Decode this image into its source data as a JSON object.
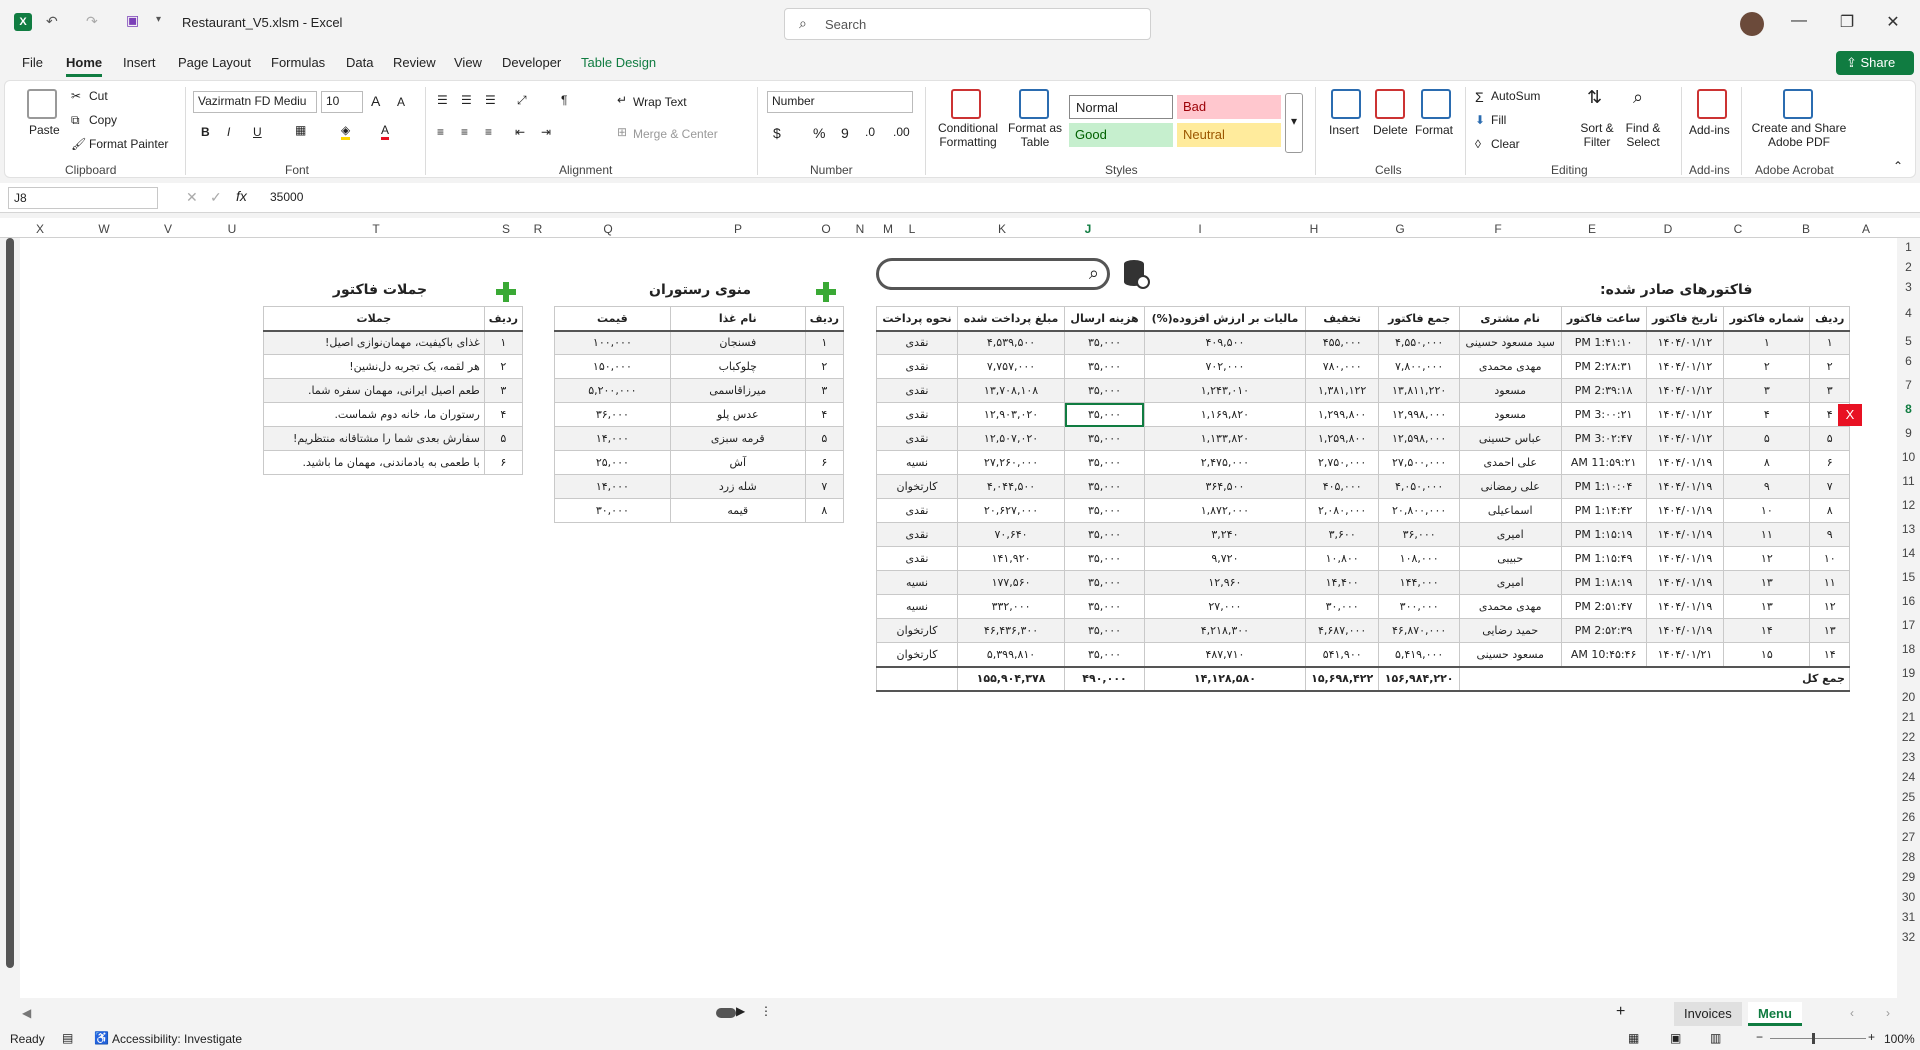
{
  "titlebar": {
    "filename": "Restaurant_V5.xlsm",
    "sep": "-",
    "app": "Excel",
    "search_placeholder": "Search"
  },
  "menu": {
    "items": [
      "File",
      "Home",
      "Insert",
      "Page Layout",
      "Formulas",
      "Data",
      "Review",
      "View",
      "Developer",
      "Table Design"
    ],
    "share": "Share"
  },
  "ribbon": {
    "clipboard": {
      "paste": "Paste",
      "cut": "Cut",
      "copy": "Copy",
      "format_painter": "Format Painter",
      "group": "Clipboard"
    },
    "font": {
      "name": "Vazirmatn FD Mediu",
      "size": "10",
      "group": "Font"
    },
    "alignment": {
      "wrap": "Wrap Text",
      "merge": "Merge & Center",
      "group": "Alignment"
    },
    "number": {
      "format": "Number",
      "group": "Number"
    },
    "styles": {
      "conditional": "Conditional Formatting",
      "format_table": "Format as Table",
      "normal": "Normal",
      "bad": "Bad",
      "good": "Good",
      "neutral": "Neutral",
      "group": "Styles"
    },
    "cells": {
      "insert": "Insert",
      "delete": "Delete",
      "format": "Format",
      "group": "Cells"
    },
    "editing": {
      "autosum": "AutoSum",
      "fill": "Fill",
      "clear": "Clear",
      "sort": "Sort & Filter",
      "find": "Find & Select",
      "group": "Editing"
    },
    "addins": {
      "label": "Add-ins",
      "group": "Add-ins"
    },
    "acrobat": {
      "label": "Create and Share Adobe PDF",
      "group": "Adobe Acrobat"
    }
  },
  "formula": {
    "cell": "J8",
    "value": "35000"
  },
  "columns": [
    "X",
    "W",
    "V",
    "U",
    "T",
    "S",
    "R",
    "Q",
    "P",
    "O",
    "N",
    "M",
    "L",
    "K",
    "J",
    "I",
    "H",
    "G",
    "F",
    "E",
    "D",
    "C",
    "B",
    "A"
  ],
  "rows": [
    "1",
    "2",
    "3",
    "4",
    "5",
    "6",
    "7",
    "8",
    "9",
    "10",
    "11",
    "12",
    "13",
    "14",
    "15",
    "16",
    "17",
    "18",
    "19",
    "20",
    "21",
    "22",
    "23",
    "24",
    "25",
    "26",
    "27",
    "28",
    "29",
    "30",
    "31",
    "32"
  ],
  "invoices": {
    "title": "فاکتورهای صادر شده:",
    "headers": [
      "ردیف",
      "شماره فاکتور",
      "تاریخ فاکتور",
      "ساعت فاکتور",
      "نام مشتری",
      "جمع فاکتور",
      "تخفیف",
      "مالیات بر ارزش افزوده(%)",
      "هزینه ارسال",
      "مبلغ پرداخت شده",
      "نحوه پرداخت"
    ],
    "rows": [
      [
        "۱",
        "۱",
        "۱۴۰۴/۰۱/۱۲",
        "1:۴۱:۱۰ PM",
        "سید مسعود حسینی",
        "۴,۵۵۰,۰۰۰",
        "۴۵۵,۰۰۰",
        "۴۰۹,۵۰۰",
        "۳۵,۰۰۰",
        "۴,۵۳۹,۵۰۰",
        "نقدی"
      ],
      [
        "۲",
        "۲",
        "۱۴۰۴/۰۱/۱۲",
        "2:۲۸:۳۱ PM",
        "مهدی محمدی",
        "۷,۸۰۰,۰۰۰",
        "۷۸۰,۰۰۰",
        "۷۰۲,۰۰۰",
        "۳۵,۰۰۰",
        "۷,۷۵۷,۰۰۰",
        "نقدی"
      ],
      [
        "۳",
        "۳",
        "۱۴۰۴/۰۱/۱۲",
        "2:۳۹:۱۸ PM",
        "مسعود",
        "۱۳,۸۱۱,۲۲۰",
        "۱,۳۸۱,۱۲۲",
        "۱,۲۴۳,۰۱۰",
        "۳۵,۰۰۰",
        "۱۳,۷۰۸,۱۰۸",
        "نقدی"
      ],
      [
        "۴",
        "۴",
        "۱۴۰۴/۰۱/۱۲",
        "3:۰۰:۲۱ PM",
        "مسعود",
        "۱۲,۹۹۸,۰۰۰",
        "۱,۲۹۹,۸۰۰",
        "۱,۱۶۹,۸۲۰",
        "۳۵,۰۰۰",
        "۱۲,۹۰۳,۰۲۰",
        "نقدی"
      ],
      [
        "۵",
        "۵",
        "۱۴۰۴/۰۱/۱۲",
        "3:۰۲:۴۷ PM",
        "عباس حسینی",
        "۱۲,۵۹۸,۰۰۰",
        "۱,۲۵۹,۸۰۰",
        "۱,۱۳۳,۸۲۰",
        "۳۵,۰۰۰",
        "۱۲,۵۰۷,۰۲۰",
        "نقدی"
      ],
      [
        "۶",
        "۸",
        "۱۴۰۴/۰۱/۱۹",
        "11:۵۹:۲۱ AM",
        "علی احمدی",
        "۲۷,۵۰۰,۰۰۰",
        "۲,۷۵۰,۰۰۰",
        "۲,۴۷۵,۰۰۰",
        "۳۵,۰۰۰",
        "۲۷,۲۶۰,۰۰۰",
        "نسیه"
      ],
      [
        "۷",
        "۹",
        "۱۴۰۴/۰۱/۱۹",
        "1:۱۰:۰۴ PM",
        "علی رمضانی",
        "۴,۰۵۰,۰۰۰",
        "۴۰۵,۰۰۰",
        "۳۶۴,۵۰۰",
        "۳۵,۰۰۰",
        "۴,۰۴۴,۵۰۰",
        "کارتخوان"
      ],
      [
        "۸",
        "۱۰",
        "۱۴۰۴/۰۱/۱۹",
        "1:۱۴:۴۲ PM",
        "اسماعیلی",
        "۲۰,۸۰۰,۰۰۰",
        "۲,۰۸۰,۰۰۰",
        "۱,۸۷۲,۰۰۰",
        "۳۵,۰۰۰",
        "۲۰,۶۲۷,۰۰۰",
        "نقدی"
      ],
      [
        "۹",
        "۱۱",
        "۱۴۰۴/۰۱/۱۹",
        "1:۱۵:۱۹ PM",
        "امیری",
        "۳۶,۰۰۰",
        "۳,۶۰۰",
        "۳,۲۴۰",
        "۳۵,۰۰۰",
        "۷۰,۶۴۰",
        "نقدی"
      ],
      [
        "۱۰",
        "۱۲",
        "۱۴۰۴/۰۱/۱۹",
        "1:۱۵:۴۹ PM",
        "حبیبی",
        "۱۰۸,۰۰۰",
        "۱۰,۸۰۰",
        "۹,۷۲۰",
        "۳۵,۰۰۰",
        "۱۴۱,۹۲۰",
        "نقدی"
      ],
      [
        "۱۱",
        "۱۳",
        "۱۴۰۴/۰۱/۱۹",
        "1:۱۸:۱۹ PM",
        "امیری",
        "۱۴۴,۰۰۰",
        "۱۴,۴۰۰",
        "۱۲,۹۶۰",
        "۳۵,۰۰۰",
        "۱۷۷,۵۶۰",
        "نسیه"
      ],
      [
        "۱۲",
        "۱۳",
        "۱۴۰۴/۰۱/۱۹",
        "2:۵۱:۴۷ PM",
        "مهدی محمدی",
        "۳۰۰,۰۰۰",
        "۳۰,۰۰۰",
        "۲۷,۰۰۰",
        "۳۵,۰۰۰",
        "۳۳۲,۰۰۰",
        "نسیه"
      ],
      [
        "۱۳",
        "۱۴",
        "۱۴۰۴/۰۱/۱۹",
        "2:۵۲:۳۹ PM",
        "حمید رضایی",
        "۴۶,۸۷۰,۰۰۰",
        "۴,۶۸۷,۰۰۰",
        "۴,۲۱۸,۳۰۰",
        "۳۵,۰۰۰",
        "۴۶,۴۳۶,۳۰۰",
        "کارتخوان"
      ],
      [
        "۱۴",
        "۱۵",
        "۱۴۰۴/۰۱/۲۱",
        "10:۴۵:۴۶ AM",
        "مسعود حسینی",
        "۵,۴۱۹,۰۰۰",
        "۵۴۱,۹۰۰",
        "۴۸۷,۷۱۰",
        "۳۵,۰۰۰",
        "۵,۳۹۹,۸۱۰",
        "کارتخوان"
      ]
    ],
    "total_label": "جمع کل",
    "totals": [
      "۱۵۶,۹۸۴,۲۲۰",
      "۱۵,۶۹۸,۴۲۲",
      "۱۴,۱۲۸,۵۸۰",
      "۴۹۰,۰۰۰",
      "۱۵۵,۹۰۴,۳۷۸"
    ]
  },
  "menu_table": {
    "title": "منوی رستوران",
    "headers": [
      "ردیف",
      "نام غذا",
      "قیمت"
    ],
    "rows": [
      [
        "۱",
        "فسنجان",
        "۱۰۰,۰۰۰"
      ],
      [
        "۲",
        "چلوکباب",
        "۱۵۰,۰۰۰"
      ],
      [
        "۳",
        "میرزاقاسمی",
        "۵,۲۰۰,۰۰۰"
      ],
      [
        "۴",
        "عدس پلو",
        "۳۶,۰۰۰"
      ],
      [
        "۵",
        "قرمه سبزی",
        "۱۴,۰۰۰"
      ],
      [
        "۶",
        "آش",
        "۲۵,۰۰۰"
      ],
      [
        "۷",
        "شله زرد",
        "۱۴,۰۰۰"
      ],
      [
        "۸",
        "قیمه",
        "۳۰,۰۰۰"
      ]
    ]
  },
  "phrases": {
    "title": "جملات فاکتور",
    "headers": [
      "ردیف",
      "جملات"
    ],
    "rows": [
      [
        "۱",
        "غذای باکیفیت، مهمان‌نوازی اصیل!"
      ],
      [
        "۲",
        "هر لقمه، یک تجربه دل‌نشین!"
      ],
      [
        "۳",
        "طعم اصیل ایرانی، مهمان سفره شما."
      ],
      [
        "۴",
        "رستوران ما، خانه دوم شماست."
      ],
      [
        "۵",
        "سفارش بعدی شما را مشتاقانه منتظریم!"
      ],
      [
        "۶",
        "با طعمی به یادماندنی، مهمان ما باشید."
      ]
    ]
  },
  "delete_btn": "X",
  "sheets": [
    "Invoices",
    "Menu"
  ],
  "status": {
    "ready": "Ready",
    "accessibility": "Accessibility: Investigate",
    "zoom": "100%"
  },
  "colors": {
    "accent": "#107c41",
    "delete": "#e81123"
  }
}
